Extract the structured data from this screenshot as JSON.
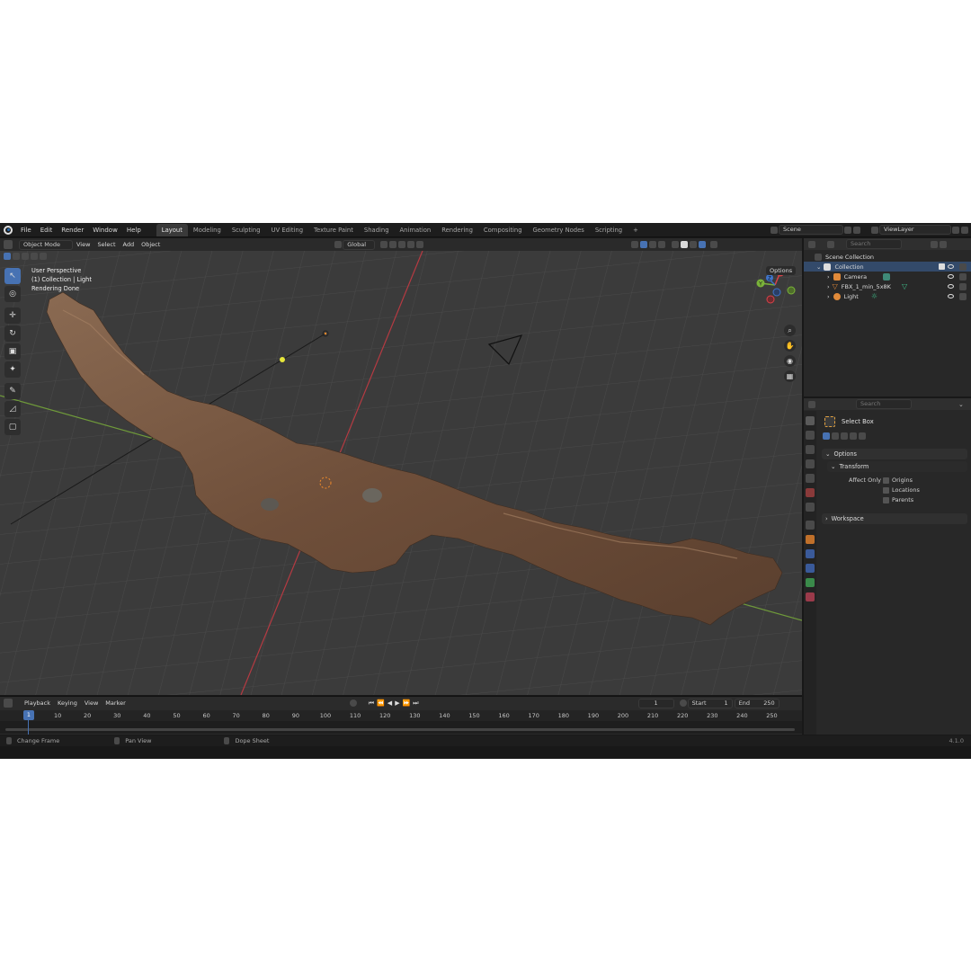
{
  "topbar": {
    "menus": [
      "File",
      "Edit",
      "Render",
      "Window",
      "Help"
    ],
    "workspaces": [
      "Layout",
      "Modeling",
      "Sculpting",
      "UV Editing",
      "Texture Paint",
      "Shading",
      "Animation",
      "Rendering",
      "Compositing",
      "Geometry Nodes",
      "Scripting"
    ],
    "active_workspace": "Layout",
    "add_tab_label": "+",
    "scene_name": "Scene",
    "view_layer_name": "ViewLayer"
  },
  "viewport": {
    "mode_label": "Object Mode",
    "menus": [
      "View",
      "Select",
      "Add",
      "Object"
    ],
    "transform_orientation": "Global",
    "options_label": "Options",
    "overlay_lines": [
      "User Perspective",
      "(1) Collection | Light",
      "Rendering Done"
    ],
    "gizmo_labels": {
      "x": "X",
      "y": "Y",
      "z": "Z"
    }
  },
  "timeline": {
    "menus": [
      "Playback",
      "Keying",
      "View",
      "Marker"
    ],
    "current_frame": "1",
    "start_label": "Start",
    "start_value": "1",
    "end_label": "End",
    "end_value": "250",
    "ruler_ticks": [
      "10",
      "20",
      "30",
      "40",
      "50",
      "60",
      "70",
      "80",
      "90",
      "100",
      "110",
      "120",
      "130",
      "140",
      "150",
      "160",
      "170",
      "180",
      "190",
      "200",
      "210",
      "220",
      "230",
      "240",
      "250"
    ],
    "playhead_label": "1"
  },
  "statusbar": {
    "items": [
      "Change Frame",
      "Pan View",
      "Dope Sheet"
    ],
    "version": "4.1.0"
  },
  "outliner": {
    "search_placeholder": "Search",
    "scene_collection": "Scene Collection",
    "collection": "Collection",
    "objects": [
      "Camera",
      "FBX_1_min_5x8K",
      "Light"
    ]
  },
  "properties": {
    "search_placeholder": "Search",
    "tool_name": "Select Box",
    "options_label": "Options",
    "transform_label": "Transform",
    "affect_only_label": "Affect Only",
    "affect_options": [
      "Origins",
      "Locations",
      "Parents"
    ],
    "workspace_label": "Workspace"
  },
  "colors": {
    "accent": "#4772b3",
    "x_axis": "#d9434a",
    "y_axis": "#7ab33a",
    "z_axis": "#3f74c9",
    "rock": "#7a5a44"
  }
}
